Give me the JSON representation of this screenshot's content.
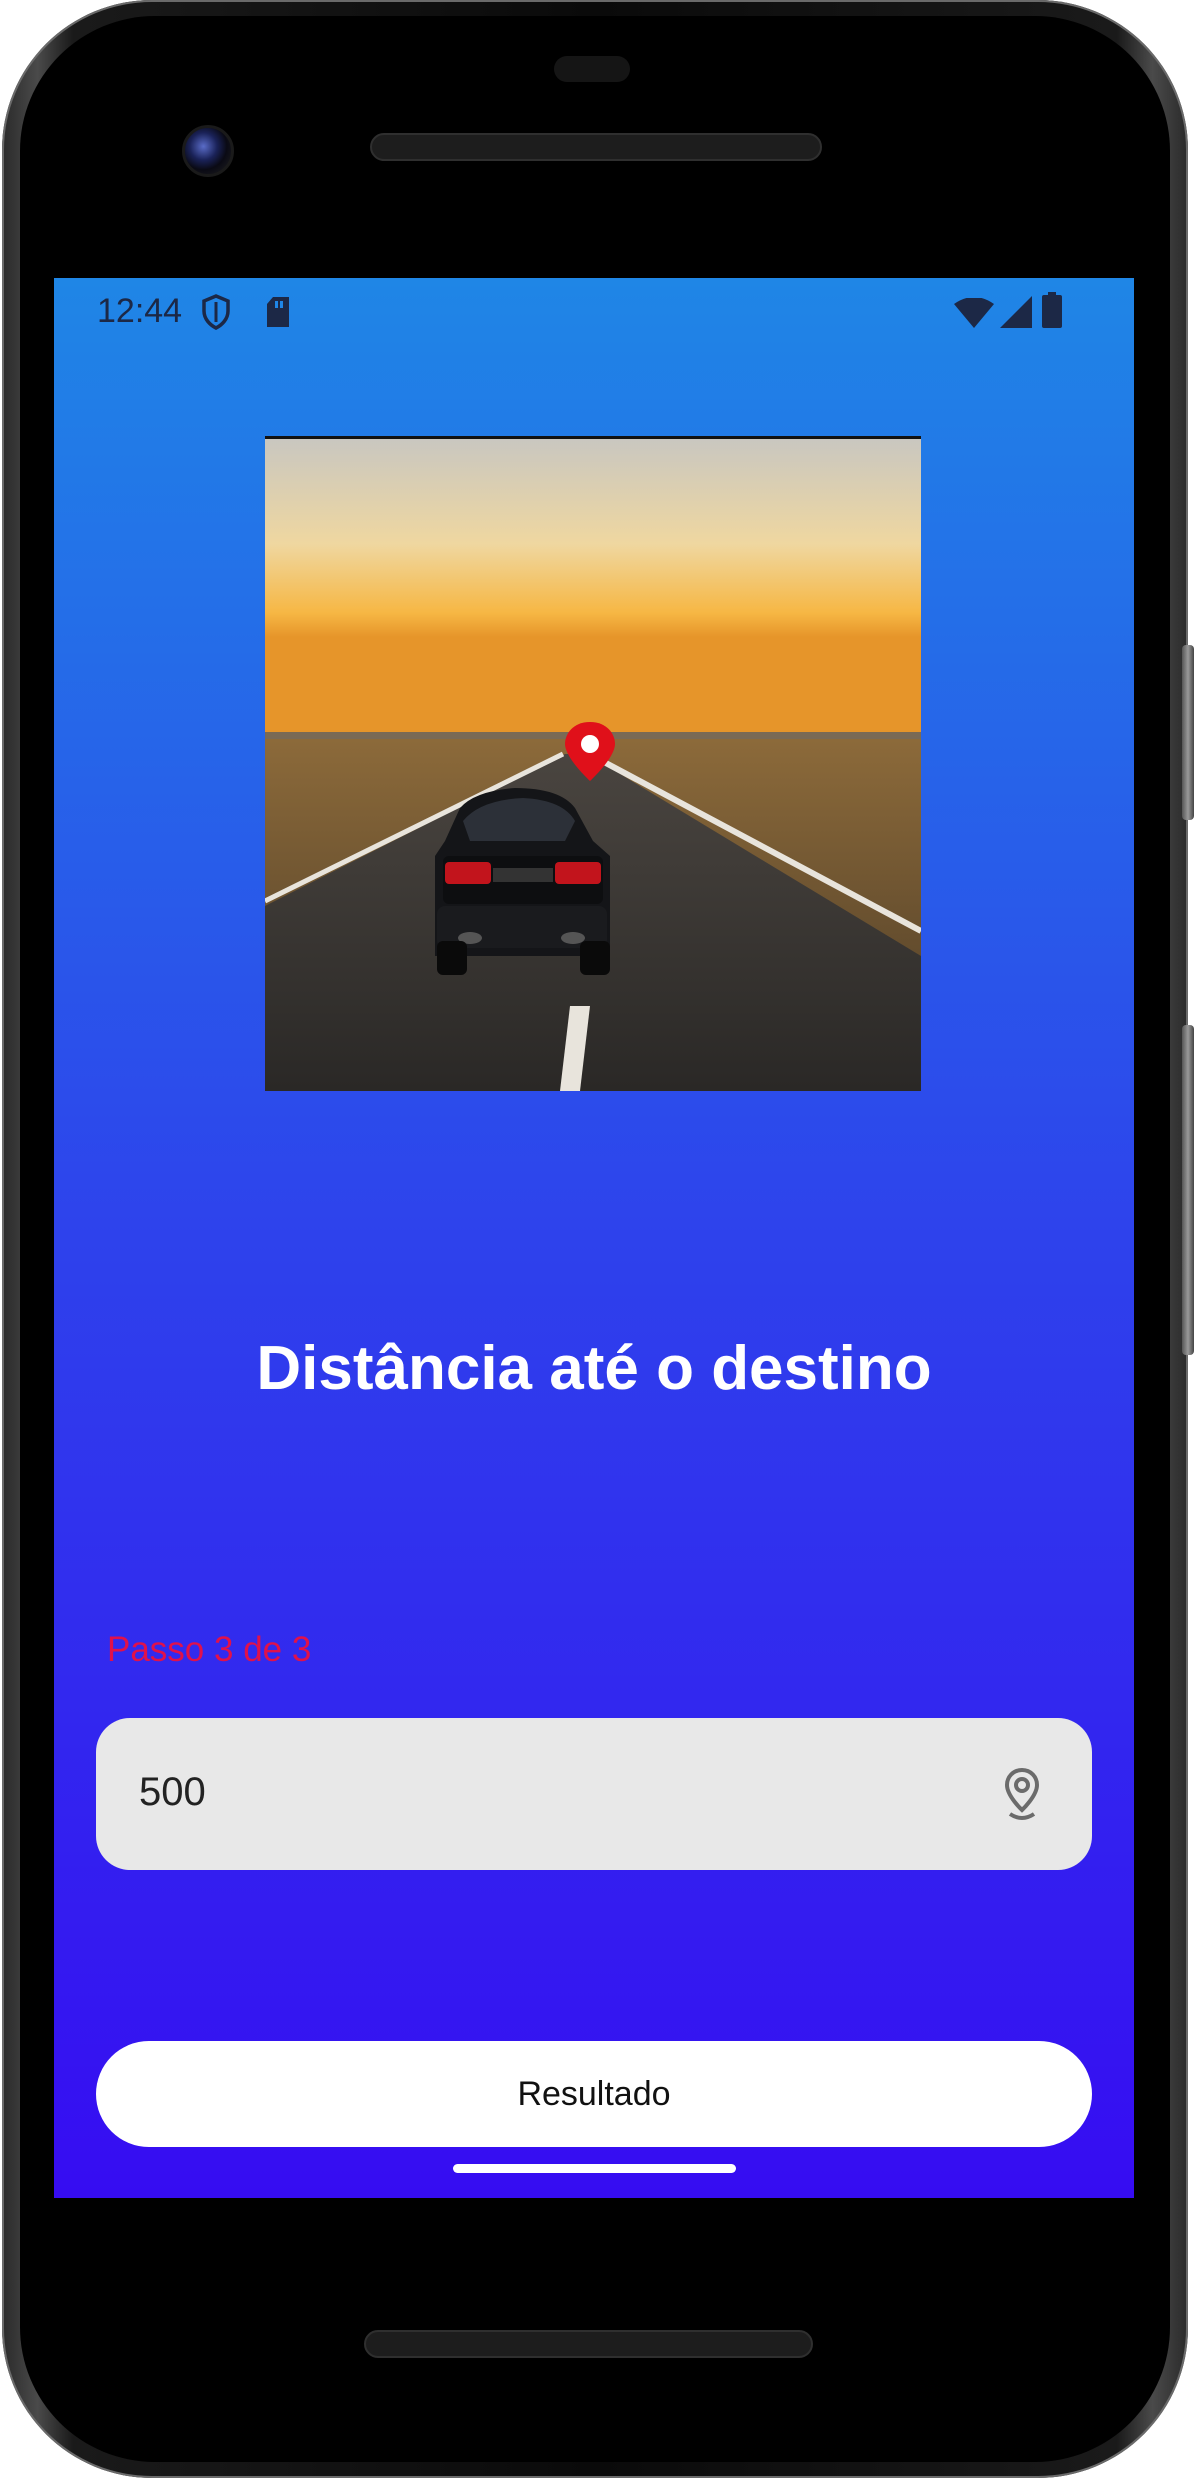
{
  "status_bar": {
    "time": "12:44",
    "left_icons": [
      "shield-icon",
      "sd-card-icon"
    ],
    "right_icons": [
      "wifi-icon",
      "cellular-signal-icon",
      "battery-icon"
    ]
  },
  "hero_image": {
    "description_icon": "car-on-road-with-location-pin"
  },
  "title": "Distância até o destino",
  "step_label": "Passo 3 de 3",
  "distance_input": {
    "value": "500",
    "icon": "location-pin-icon"
  },
  "result_button": {
    "label": "Resultado"
  },
  "colors": {
    "gradient_top": "#1f86e6",
    "gradient_bottom": "#360cf2",
    "step_label": "#e0114b",
    "input_bg": "#e8e8e8",
    "button_bg": "#ffffff"
  }
}
